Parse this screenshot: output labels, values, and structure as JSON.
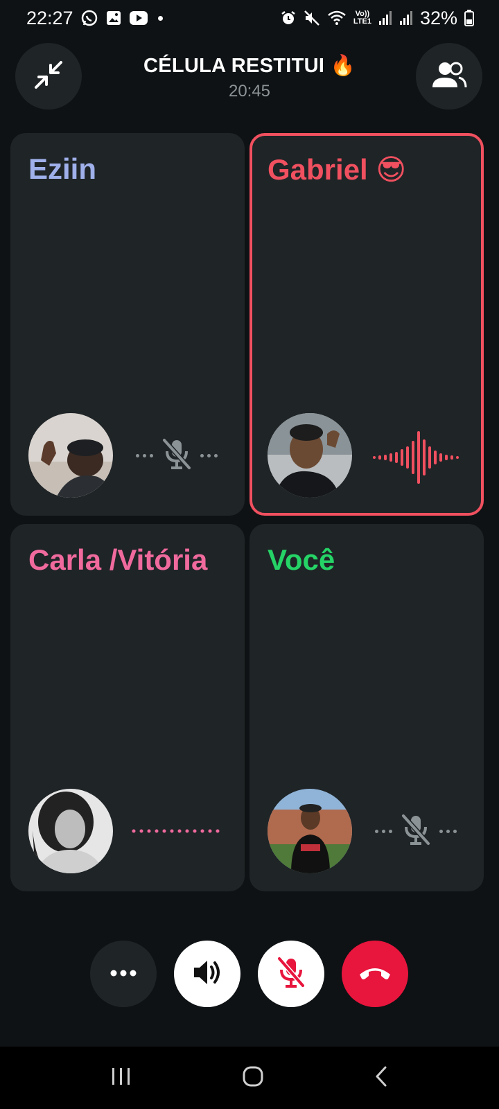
{
  "status_bar": {
    "time": "22:27",
    "battery": "32%",
    "left_icons": [
      "whatsapp-icon",
      "gallery-icon",
      "youtube-icon"
    ],
    "right_icons": [
      "alarm-icon",
      "mute-icon",
      "wifi-icon",
      "volte-icon",
      "signal-icon",
      "signal-icon",
      "battery-icon"
    ]
  },
  "call": {
    "title": "CÉLULA RESTITUI 🔥",
    "timer": "20:45"
  },
  "participants": [
    {
      "name": "Eziin",
      "name_color": "#9fb0ea",
      "state": "muted",
      "speaking": false
    },
    {
      "name": "Gabriel 😎",
      "name_color": "#f0505f",
      "state": "speaking",
      "speaking": true
    },
    {
      "name": "Carla /Vitória",
      "name_color": "#f06a9e",
      "state": "connecting",
      "speaking": false
    },
    {
      "name": "Você",
      "name_color": "#25d366",
      "state": "muted",
      "speaking": false
    }
  ],
  "controls": [
    "more-options",
    "speaker",
    "mute-microphone",
    "end-call"
  ],
  "colors": {
    "background": "#0e1214",
    "tile": "#1f2427",
    "accent_red": "#e8153d",
    "speaking_border": "#f0505f"
  }
}
